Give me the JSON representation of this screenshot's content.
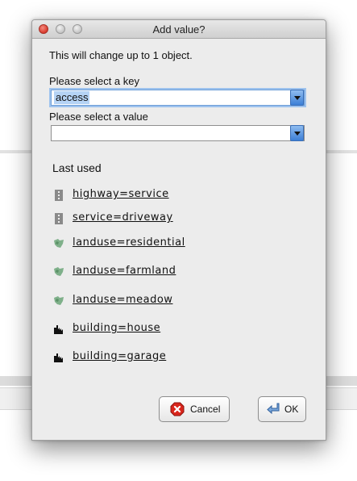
{
  "window": {
    "title": "Add value?"
  },
  "info_text": "This will change up to 1 object.",
  "key_field": {
    "label": "Please select a key",
    "value": "access"
  },
  "value_field": {
    "label": "Please select a value",
    "value": ""
  },
  "recent": {
    "heading": "Last used",
    "items": [
      {
        "tag": "highway=service",
        "icon": "road-sign-icon"
      },
      {
        "tag": "service=driveway",
        "icon": "road-sign-icon"
      },
      {
        "tag": "landuse=residential",
        "icon": "landuse-map-icon"
      },
      {
        "tag": "landuse=farmland",
        "icon": "landuse-map-icon"
      },
      {
        "tag": "landuse=meadow",
        "icon": "landuse-map-icon"
      },
      {
        "tag": "building=house",
        "icon": "building-icon"
      },
      {
        "tag": "building=garage",
        "icon": "building-icon"
      }
    ]
  },
  "buttons": {
    "cancel": "Cancel",
    "ok": "OK"
  }
}
